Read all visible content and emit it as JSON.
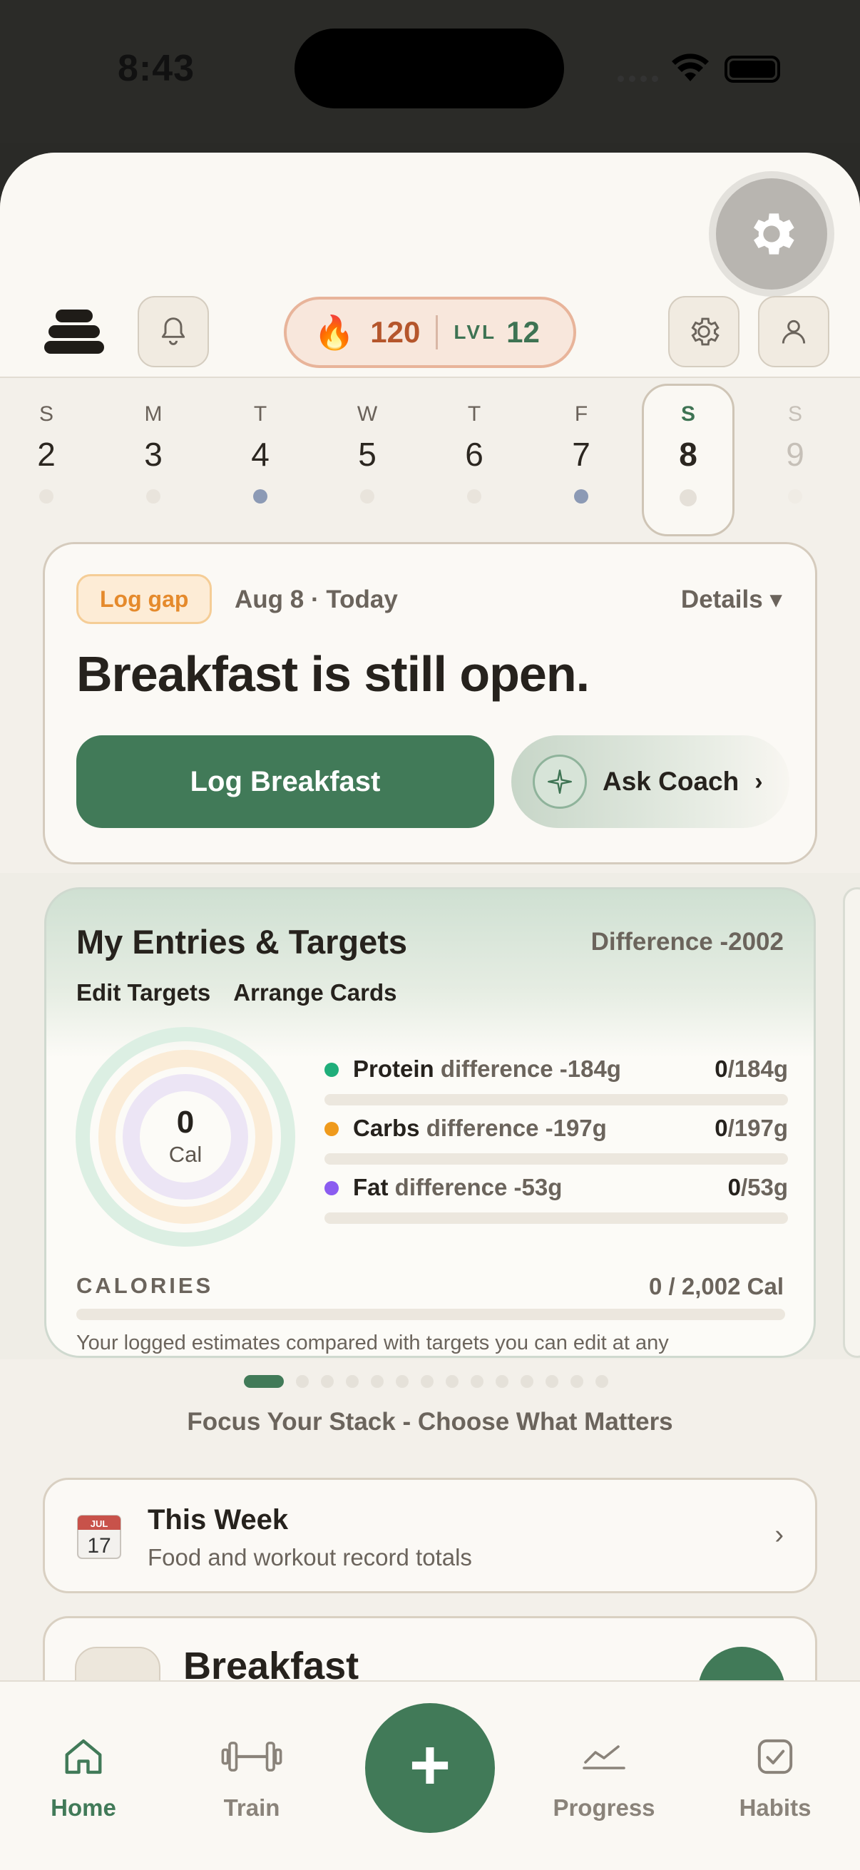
{
  "status_bar": {
    "time": "8:43"
  },
  "header": {
    "streak_count": "120",
    "level_label": "LVL",
    "level_value": "12"
  },
  "week": {
    "days": [
      {
        "letter": "S",
        "number": "2",
        "dot": "empty"
      },
      {
        "letter": "M",
        "number": "3",
        "dot": "empty"
      },
      {
        "letter": "T",
        "number": "4",
        "dot": "logged"
      },
      {
        "letter": "W",
        "number": "5",
        "dot": "empty"
      },
      {
        "letter": "T",
        "number": "6",
        "dot": "empty"
      },
      {
        "letter": "F",
        "number": "7",
        "dot": "logged"
      },
      {
        "letter": "S",
        "number": "8",
        "dot": "empty",
        "selected": true
      },
      {
        "letter": "S",
        "number": "9",
        "dot": "empty",
        "future": true
      }
    ]
  },
  "log_gap": {
    "badge": "Log gap",
    "date": "Aug 8 · Today",
    "details": "Details ▾",
    "title": "Breakfast is still open.",
    "primary_button": "Log Breakfast",
    "coach_button": "Ask Coach",
    "coach_chevron": "›"
  },
  "entries": {
    "title": "My Entries & Targets",
    "difference": "Difference -2002",
    "links": [
      "Edit Targets",
      "Arrange Cards"
    ],
    "ring_value": "0",
    "ring_unit": "Cal",
    "macros": [
      {
        "name": "Protein",
        "diff": "difference -184g",
        "current": "0",
        "target": "/184g",
        "color": "#1fae7a",
        "progress": 0
      },
      {
        "name": "Carbs",
        "diff": "difference -197g",
        "current": "0",
        "target": "/197g",
        "color": "#ef9a1c",
        "progress": 0
      },
      {
        "name": "Fat",
        "diff": "difference -53g",
        "current": "0",
        "target": "/53g",
        "color": "#8b5cf0",
        "progress": 0
      }
    ],
    "calories_label": "CALORIES",
    "calories_value": "0 / 2,002 Cal",
    "calories_progress": 0,
    "note": "Your logged estimates compared with targets you can edit at any"
  },
  "pager": {
    "total": 14,
    "active_index": 0
  },
  "focus_text": "Focus Your Stack - Choose What Matters",
  "this_week": {
    "calendar_month": "JUL",
    "calendar_day": "17",
    "title": "This Week",
    "subtitle": "Food and workout record totals",
    "chevron": "›"
  },
  "breakfast_card": {
    "title": "Breakfast"
  },
  "tabs": [
    {
      "label": "Home",
      "icon": "home-icon",
      "active": true
    },
    {
      "label": "Train",
      "icon": "dumbbell-icon"
    },
    {
      "label": "Progress",
      "icon": "chart-line-icon"
    },
    {
      "label": "Habits",
      "icon": "checkbox-icon"
    }
  ],
  "fab_label": "+",
  "colors": {
    "brand_green": "#417a58",
    "streak_orange": "#b5562c",
    "background": "#f3f0ea"
  }
}
